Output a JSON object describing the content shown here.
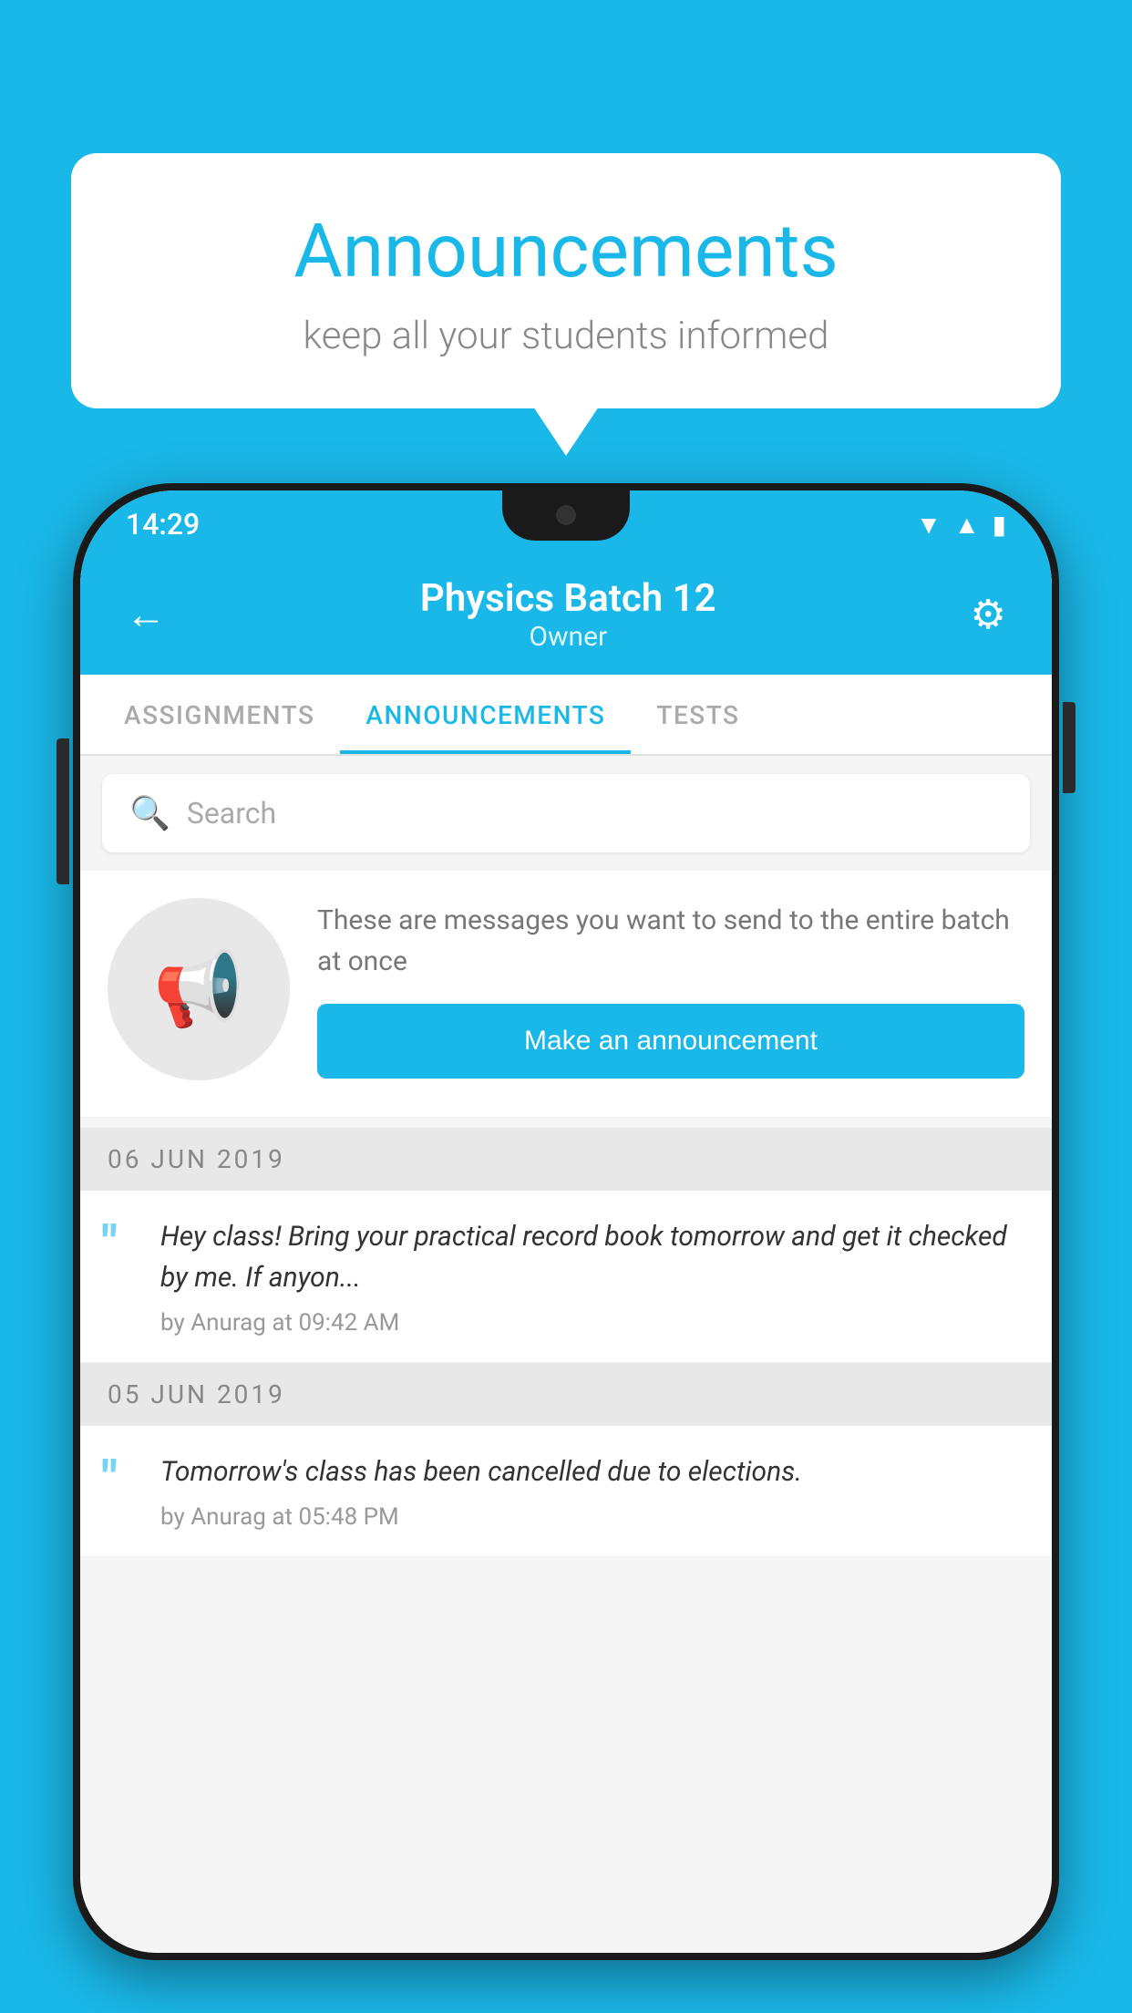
{
  "background_color": "#1ab8e8",
  "bubble": {
    "title": "Announcements",
    "subtitle": "keep all your students informed"
  },
  "phone": {
    "status_bar": {
      "time": "14:29"
    },
    "header": {
      "back_label": "←",
      "title": "Physics Batch 12",
      "subtitle": "Owner",
      "gear_label": "⚙"
    },
    "tabs": [
      {
        "label": "ASSIGNMENTS",
        "active": false
      },
      {
        "label": "ANNOUNCEMENTS",
        "active": true
      },
      {
        "label": "TESTS",
        "active": false
      }
    ],
    "search": {
      "placeholder": "Search"
    },
    "promo": {
      "icon": "📢",
      "description": "These are messages you want to send to the entire batch at once",
      "button_label": "Make an announcement"
    },
    "announcements": [
      {
        "date": "06  JUN  2019",
        "text": "Hey class! Bring your practical record book tomorrow and get it checked by me. If anyon...",
        "meta": "by Anurag at 09:42 AM"
      },
      {
        "date": "05  JUN  2019",
        "text": "Tomorrow's class has been cancelled due to elections.",
        "meta": "by Anurag at 05:48 PM"
      }
    ]
  }
}
